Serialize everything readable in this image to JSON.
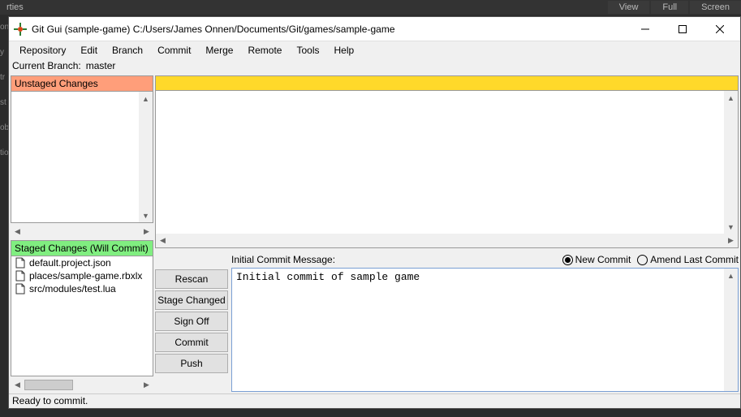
{
  "backdrop": {
    "tab": "rties",
    "left_fragments": [
      "on",
      "y",
      "tr",
      "st",
      "ob",
      "tio"
    ],
    "right_menus": [
      "View",
      "Full",
      "Screen"
    ]
  },
  "window": {
    "title": "Git Gui (sample-game) C:/Users/James Onnen/Documents/Git/games/sample-game"
  },
  "menubar": [
    "Repository",
    "Edit",
    "Branch",
    "Commit",
    "Merge",
    "Remote",
    "Tools",
    "Help"
  ],
  "branch": {
    "label": "Current Branch:",
    "name": "master"
  },
  "panels": {
    "unstaged_header": "Unstaged Changes",
    "staged_header": "Staged Changes (Will Commit)",
    "staged_files": [
      "default.project.json",
      "places/sample-game.rbxlx",
      "src/modules/test.lua"
    ]
  },
  "commit": {
    "msg_label": "Initial Commit Message:",
    "radio_new": "New Commit",
    "radio_amend": "Amend Last Commit",
    "message": "Initial commit of sample game",
    "buttons": {
      "rescan": "Rescan",
      "stage_changed": "Stage Changed",
      "sign_off": "Sign Off",
      "commit": "Commit",
      "push": "Push"
    }
  },
  "status": "Ready to commit."
}
